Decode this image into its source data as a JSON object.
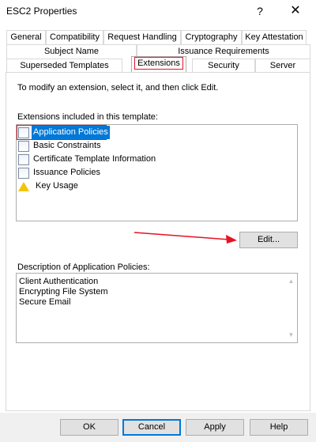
{
  "window": {
    "title": "ESC2 Properties",
    "help_glyph": "?",
    "close_glyph": "✕"
  },
  "tabs": {
    "row1": [
      "General",
      "Compatibility",
      "Request Handling",
      "Cryptography",
      "Key Attestation"
    ],
    "row2": [
      "Subject Name",
      "Issuance Requirements"
    ],
    "row3": [
      "Superseded Templates",
      "Extensions",
      "Security",
      "Server"
    ],
    "active": "Extensions"
  },
  "extensions_tab": {
    "instruction": "To modify an extension, select it, and then click Edit.",
    "list_label": "Extensions included in this template:",
    "items": [
      {
        "label": "Application Policies",
        "icon": "document-icon",
        "selected": true
      },
      {
        "label": "Basic Constraints",
        "icon": "document-icon",
        "selected": false
      },
      {
        "label": "Certificate Template Information",
        "icon": "document-icon",
        "selected": false
      },
      {
        "label": "Issuance Policies",
        "icon": "document-icon",
        "selected": false
      },
      {
        "label": "Key Usage",
        "icon": "warning-document-icon",
        "selected": false
      }
    ],
    "edit_label": "Edit...",
    "description_label": "Description of Application Policies:",
    "description_lines": [
      "Client Authentication",
      "Encrypting File System",
      "Secure Email"
    ]
  },
  "footer": {
    "ok": "OK",
    "cancel": "Cancel",
    "apply": "Apply",
    "help": "Help"
  },
  "colors": {
    "selection": "#0078d7",
    "annotation_red": "#e81123"
  }
}
